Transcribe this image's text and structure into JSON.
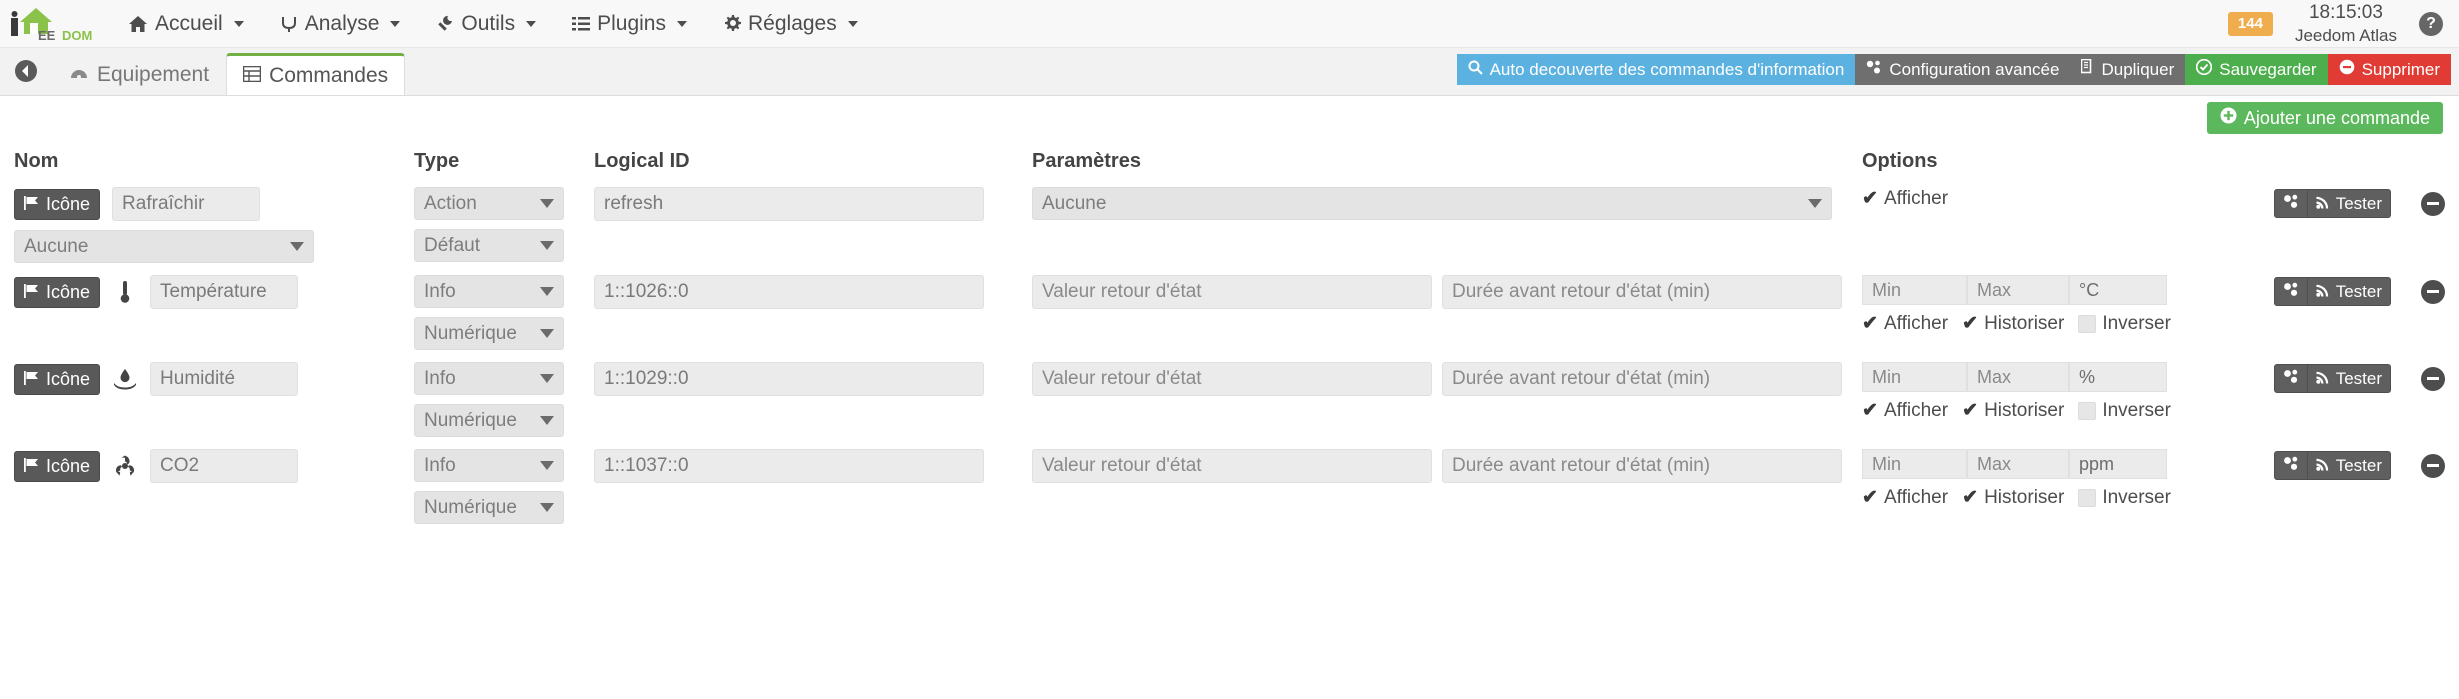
{
  "navbar": {
    "brand": "JEEDOM",
    "items": [
      {
        "label": "Accueil",
        "icon": "home-icon"
      },
      {
        "label": "Analyse",
        "icon": "analysis-icon"
      },
      {
        "label": "Outils",
        "icon": "wrench-icon"
      },
      {
        "label": "Plugins",
        "icon": "list-icon"
      },
      {
        "label": "Réglages",
        "icon": "gear-icon"
      }
    ],
    "badge": "144",
    "time": "18:15:03",
    "instance": "Jeedom Atlas",
    "help": "?"
  },
  "tabs": {
    "back": "back-arrow-icon",
    "items": [
      {
        "label": "Equipement",
        "icon": "dashboard-icon",
        "active": false
      },
      {
        "label": "Commandes",
        "icon": "table-icon",
        "active": true
      }
    ]
  },
  "toolbar": {
    "autodiscover": "Auto decouverte des commandes d'information",
    "advanced": "Configuration avancée",
    "duplicate": "Dupliquer",
    "save": "Sauvegarder",
    "delete": "Supprimer",
    "add_command": "Ajouter une commande"
  },
  "colors": {
    "info": "#5bb1e0",
    "default": "#6f6f6f",
    "success": "#4cae4c",
    "danger": "#e03b34",
    "add": "#5cb85c",
    "badge": "#f0ad4e",
    "tab_accent": "#72b043"
  },
  "table": {
    "headers": {
      "nom": "Nom",
      "type": "Type",
      "logical_id": "Logical ID",
      "parametres": "Paramètres",
      "options": "Options"
    },
    "icone_label": "Icône",
    "tester_label": "Tester",
    "placeholders": {
      "valeur_retour": "Valeur retour d'état",
      "duree_retour": "Durée avant retour d'état (min)",
      "min": "Min",
      "max": "Max"
    },
    "labels": {
      "afficher": "Afficher",
      "historiser": "Historiser",
      "inverser": "Inverser"
    },
    "rows": [
      {
        "kind": "action",
        "icon": "flag-icon",
        "type_icon": null,
        "name": "Rafraîchir",
        "type": "Action",
        "subtype": "Défaut",
        "value_select": "Aucune",
        "logical_id": "refresh",
        "param_select": "Aucune",
        "afficher": true,
        "historiser": null,
        "inverser": null,
        "unit": null
      },
      {
        "kind": "info",
        "icon": "flag-icon",
        "type_icon": "thermometer-icon",
        "name": "Température",
        "type": "Info",
        "subtype": "Numérique",
        "logical_id": "1::1026::0",
        "unit": "°C",
        "afficher": true,
        "historiser": true,
        "inverser": false
      },
      {
        "kind": "info",
        "icon": "flag-icon",
        "type_icon": "humidity-icon",
        "name": "Humidité",
        "type": "Info",
        "subtype": "Numérique",
        "logical_id": "1::1029::0",
        "unit": "%",
        "afficher": true,
        "historiser": true,
        "inverser": false
      },
      {
        "kind": "info",
        "icon": "flag-icon",
        "type_icon": "biohazard-icon",
        "name": "CO2",
        "type": "Info",
        "subtype": "Numérique",
        "logical_id": "1::1037::0",
        "unit": "ppm",
        "afficher": true,
        "historiser": true,
        "inverser": false
      }
    ]
  }
}
